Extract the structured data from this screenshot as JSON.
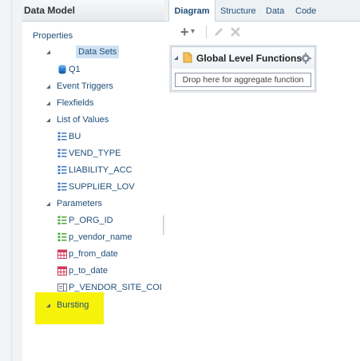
{
  "data_model": {
    "title": "Data Model",
    "tree": {
      "properties": "Properties",
      "data_sets": "Data Sets",
      "q1": "Q1",
      "event_triggers": "Event Triggers",
      "flexfields": "Flexfields",
      "list_of_values": "List of Values",
      "lov_items": [
        "BU",
        "VEND_TYPE",
        "LIABILITY_ACC",
        "SUPPLIER_LOV"
      ],
      "parameters": "Parameters",
      "param_items": [
        "P_ORG_ID",
        "p_vendor_name",
        "p_from_date",
        "p_to_date",
        "P_VENDOR_SITE_COD"
      ],
      "bursting": "Bursting"
    }
  },
  "editor": {
    "tabs": [
      "Diagram",
      "Structure",
      "Data",
      "Code"
    ],
    "active_tab": "Diagram",
    "toolbar": {
      "add": "+",
      "add_caret": "▾",
      "edit_icon": "pencil-icon",
      "delete_icon": "close-icon"
    },
    "global_level_functions": {
      "title": "Global Level Functions",
      "drop_placeholder": "Drop here for aggregate function"
    }
  },
  "colors": {
    "highlight": "#f6f20a",
    "link": "#1f4e79",
    "selection": "#cfe2f3"
  }
}
